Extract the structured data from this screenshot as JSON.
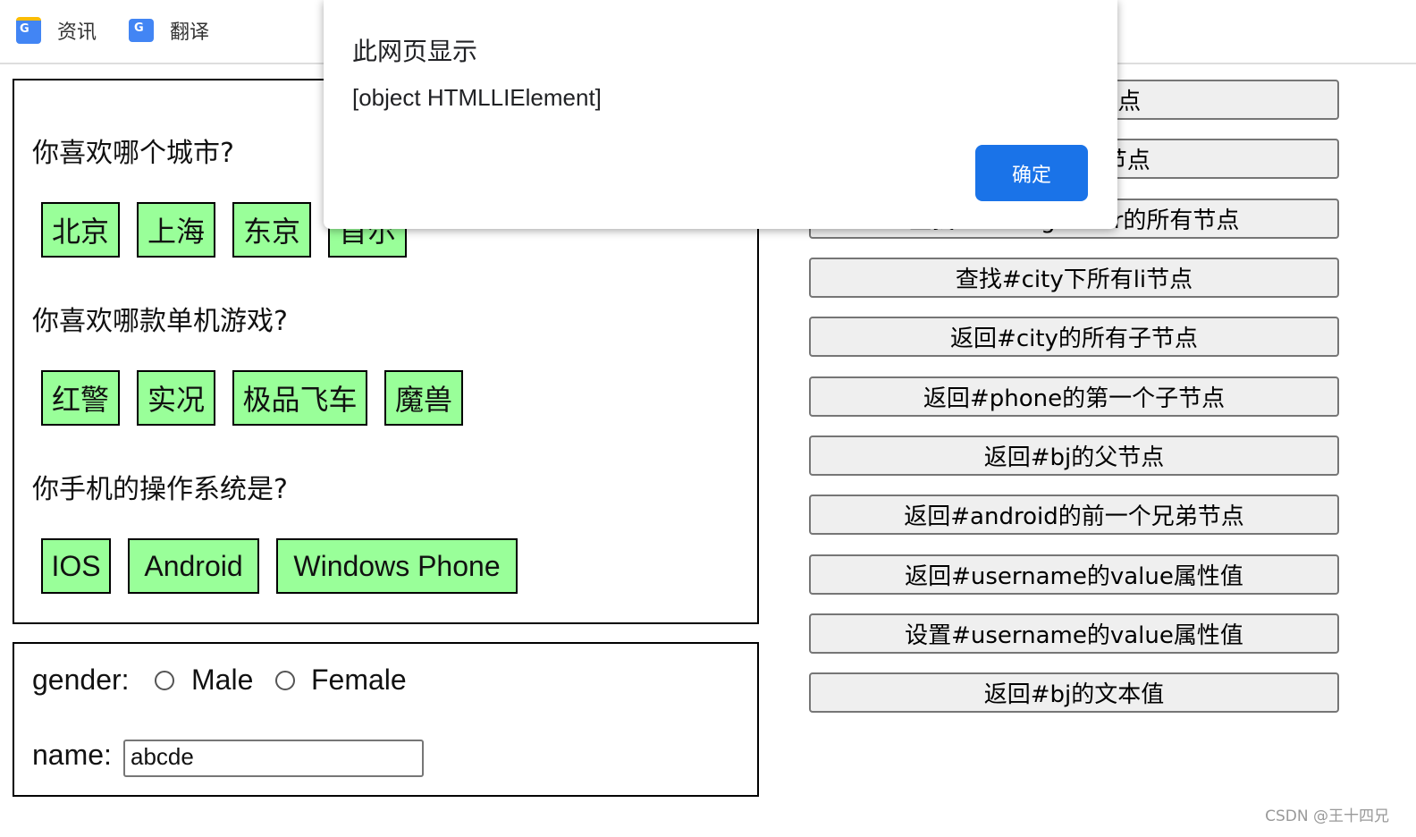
{
  "bookmarks": [
    {
      "label": "资讯",
      "icon": "google-news-icon"
    },
    {
      "label": "翻译",
      "icon": "google-translate-icon"
    }
  ],
  "questions": {
    "city": {
      "label": "你喜欢哪个城市?",
      "options": [
        "北京",
        "上海",
        "东京",
        "首尔"
      ]
    },
    "game": {
      "label": "你喜欢哪款单机游戏?",
      "options": [
        "红警",
        "实况",
        "极品飞车",
        "魔兽"
      ]
    },
    "phone": {
      "label": "你手机的操作系统是?",
      "options": [
        "IOS",
        "Android",
        "Windows Phone"
      ]
    }
  },
  "form": {
    "gender_label": "gender:",
    "male": "Male",
    "female": "Female",
    "name_label": "name:",
    "name_value": "abcde"
  },
  "buttons": [
    "查找#bj节点",
    "查找所有li节点",
    "查找name=gender的所有节点",
    "查找#city下所有li节点",
    "返回#city的所有子节点",
    "返回#phone的第一个子节点",
    "返回#bj的父节点",
    "返回#android的前一个兄弟节点",
    "返回#username的value属性值",
    "设置#username的value属性值",
    "返回#bj的文本值"
  ],
  "dialog": {
    "title": "此网页显示",
    "message": "[object HTMLLIElement]",
    "ok": "确定"
  },
  "watermark": "CSDN @王十四兄",
  "colors": {
    "option_bg": "#99ff99",
    "ok_button": "#1a73e8"
  }
}
